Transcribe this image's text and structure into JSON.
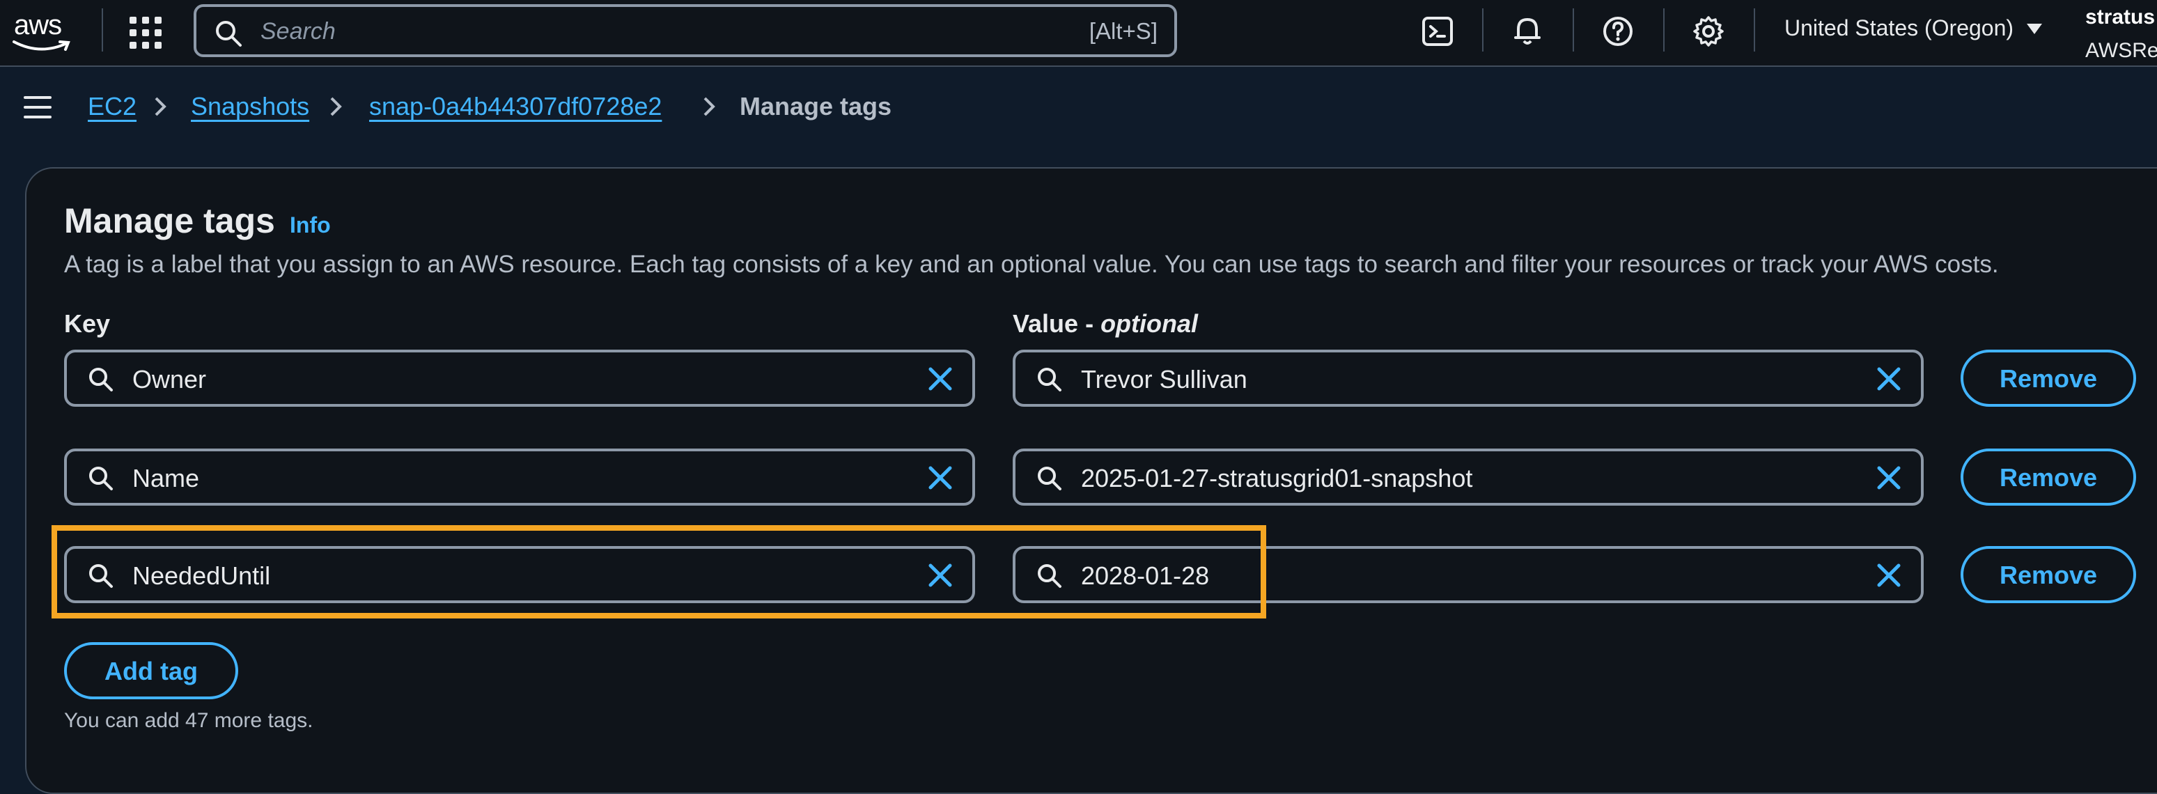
{
  "topnav": {
    "logo_text": "aws",
    "search_placeholder": "Search",
    "search_shortcut": "[Alt+S]",
    "icons": [
      "cloudshell-icon",
      "bell-icon",
      "help-icon",
      "gear-icon"
    ],
    "region": "United States (Oregon)",
    "account_name": "stratus",
    "account_sub": "AWSRe"
  },
  "breadcrumb": {
    "items": [
      "EC2",
      "Snapshots",
      "snap-0a4b44307df0728e2",
      "Manage tags"
    ]
  },
  "panel": {
    "title": "Manage tags",
    "info_link": "Info",
    "description": "A tag is a label that you assign to an AWS resource. Each tag consists of a key and an optional value. You can use tags to search and filter your resources or track your AWS costs.",
    "key_label": "Key",
    "value_label": "Value - ",
    "value_label_optional": "optional",
    "tags": [
      {
        "key": "Owner",
        "value": "Trevor Sullivan",
        "remove_label": "Remove"
      },
      {
        "key": "Name",
        "value": "2025-01-27-stratusgrid01-snapshot",
        "remove_label": "Remove"
      },
      {
        "key": "NeededUntil",
        "value": "2028-01-28",
        "remove_label": "Remove"
      }
    ],
    "add_tag_label": "Add tag",
    "helper_text": "You can add 47 more tags."
  },
  "colors": {
    "background": "#0f141a",
    "link": "#42b4ff",
    "highlight": "#f5a623",
    "border": "#8d99a8"
  }
}
